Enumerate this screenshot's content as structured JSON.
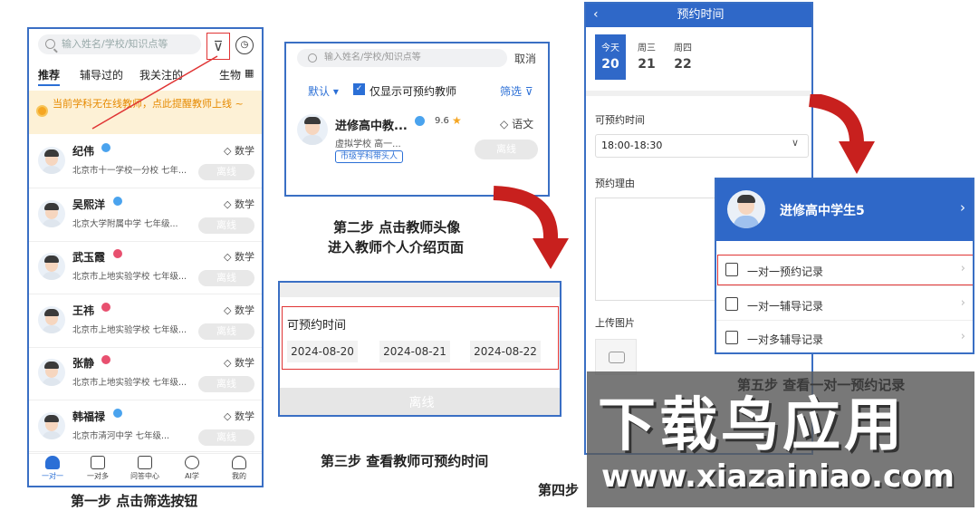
{
  "panel1": {
    "search_placeholder": "输入姓名/学校/知识点等",
    "tabs": [
      "推荐",
      "辅导过的",
      "我关注的"
    ],
    "subject_filter": "生物",
    "notice": "当前学科无在线教师，点此提醒教师上线 ~",
    "teachers": [
      {
        "name": "纪伟",
        "school": "北京市十一学校一分校   七年...",
        "subject": "数学",
        "status": "离线"
      },
      {
        "name": "吴熙洋",
        "school": "北京大学附属中学   七年级...",
        "subject": "数学",
        "status": "离线"
      },
      {
        "name": "武玉霞",
        "school": "北京市上地实验学校   七年级...",
        "subject": "数学",
        "status": "离线"
      },
      {
        "name": "王祎",
        "school": "北京市上地实验学校   七年级...",
        "subject": "数学",
        "status": "离线"
      },
      {
        "name": "张静",
        "school": "北京市上地实验学校   七年级...",
        "subject": "数学",
        "status": "离线"
      },
      {
        "name": "韩福禄",
        "school": "北京市清河中学   七年级...",
        "subject": "数学",
        "status": "离线"
      }
    ],
    "nav": [
      "一对一",
      "一对多",
      "问答中心",
      "AI学",
      "我的"
    ]
  },
  "caption1": "第一步 点击筛选按钮",
  "panel2": {
    "search_placeholder": "输入姓名/学校/知识点等",
    "cancel": "取消",
    "sort": "默认 ▾",
    "checkbox_label": "仅显示可预约教师",
    "filter": "筛选",
    "teacher_name": "进修高中教...",
    "rating": "9.6",
    "subject": "语文",
    "school": "虚拟学校   高一...",
    "tag": "市级学科带头人",
    "status": "离线"
  },
  "caption2_line1": "第二步 点击教师头像",
  "caption2_line2": "进入教师个人介绍页面",
  "panel3": {
    "title": "可预约时间",
    "dates": [
      "2024-08-20",
      "2024-08-21",
      "2024-08-22"
    ],
    "status": "离线"
  },
  "caption3": "第三步 查看教师可预约时间",
  "panel4": {
    "title": "预约时间",
    "days": [
      {
        "label": "今天",
        "num": "20"
      },
      {
        "label": "周三",
        "num": "21"
      },
      {
        "label": "周四",
        "num": "22"
      }
    ],
    "time_label": "可预约时间",
    "time_value": "18:00-18:30",
    "reason_label": "预约理由",
    "upload_label": "上传图片"
  },
  "caption4": "第四步",
  "panel5": {
    "name": "进修高中学生5",
    "items": [
      "一对一预约记录",
      "一对一辅导记录",
      "一对多辅导记录"
    ]
  },
  "caption5": "第五步 查看一对一预约记录",
  "watermark": {
    "title": "下载鸟应用",
    "url": "www.xiazainiao.com"
  },
  "colors": {
    "brand_blue": "#2f68c8",
    "highlight_red": "#e03434",
    "notice_bg": "#fdf1d6",
    "notice_text": "#e68a00"
  }
}
